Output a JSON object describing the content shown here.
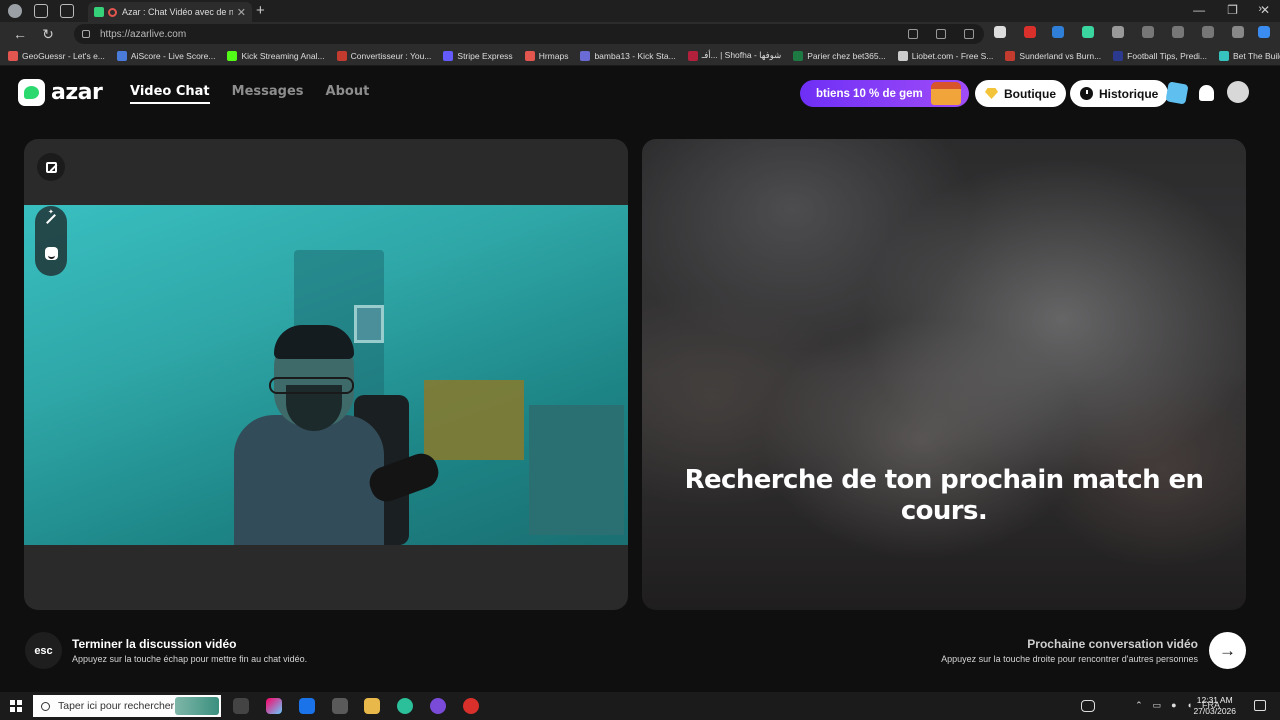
{
  "browser": {
    "tab_title": "Azar : Chat Vidéo avec de n",
    "url": "https://azarlive.com",
    "bookmarks": [
      {
        "label": "GeoGuessr - Let's e...",
        "color": "#e2564f"
      },
      {
        "label": "AiScore - Live Score...",
        "color": "#4a7bd8"
      },
      {
        "label": "Kick Streaming Anal...",
        "color": "#53fc18"
      },
      {
        "label": "Convertisseur : You...",
        "color": "#c23b2e"
      },
      {
        "label": "Stripe Express",
        "color": "#635bff"
      },
      {
        "label": "Hrmaps",
        "color": "#e2564f"
      },
      {
        "label": "bamba13 - Kick Sta...",
        "color": "#6b6bd6"
      },
      {
        "label": "أفـ... | Shofha - شوفها",
        "color": "#b2203c"
      },
      {
        "label": "Parier chez bet365...",
        "color": "#1d7a43"
      },
      {
        "label": "Liobet.com - Free S...",
        "color": "#ccc"
      },
      {
        "label": "Sunderland vs Burn...",
        "color": "#c23b2e"
      },
      {
        "label": "Football Tips, Predi...",
        "color": "#2b3a8f"
      },
      {
        "label": "Bet The Builder",
        "color": "#36c3c0"
      }
    ]
  },
  "header": {
    "logo_text": "azar",
    "nav": [
      "Video Chat",
      "Messages",
      "About"
    ],
    "promo_text": "btiens 10 % de gem",
    "boutique_label": "Boutique",
    "historique_label": "Historique"
  },
  "main": {
    "searching_text": "Recherche de ton prochain match en cours."
  },
  "controls": {
    "esc_label": "esc",
    "end_title": "Terminer la discussion vidéo",
    "end_sub": "Appuyez sur la touche échap pour mettre fin au chat vidéo.",
    "next_title": "Prochaine conversation vidéo",
    "next_sub": "Appuyez sur la touche droite pour rencontrer d'autres personnes",
    "next_arrow": "→"
  },
  "taskbar": {
    "search_placeholder": "Taper ici pour rechercher",
    "lang": "FRA",
    "time": "12:31 AM",
    "date": "27/03/2026"
  }
}
